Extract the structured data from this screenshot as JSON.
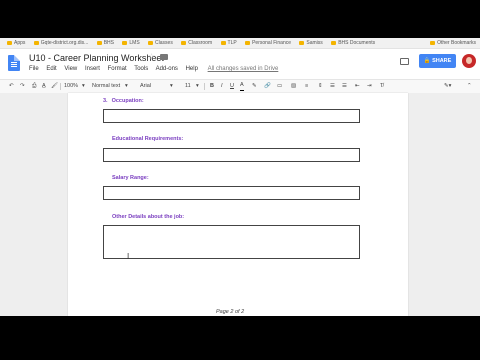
{
  "bookmarks": [
    "Apps",
    "Gqte-district.org.dis...",
    "BHS",
    "LMS",
    "Classes",
    "Classroom",
    "TLP",
    "Personal Finance",
    "Samiss",
    "BHS Documents"
  ],
  "bookmarks_right": "Other Bookmarks",
  "doc": {
    "title": "U10 - Career Planning Worksheet",
    "menu": [
      "File",
      "Edit",
      "View",
      "Insert",
      "Format",
      "Tools",
      "Add-ons",
      "Help"
    ],
    "save_status": "All changes saved in Drive",
    "share_label": "SHARE"
  },
  "toolbar": {
    "zoom": "100%",
    "style": "Normal text",
    "font": "Arial",
    "size": "11"
  },
  "content": {
    "q_number": "3.",
    "occupation_label": "Occupation:",
    "education_label": "Educational Requirements:",
    "salary_label": "Salary Range:",
    "other_label": "Other Details about the job:",
    "page_footer": "Page 2 of 2"
  },
  "colors": {
    "label_purple": "#7b3fc0",
    "share_blue": "#4285f4"
  }
}
